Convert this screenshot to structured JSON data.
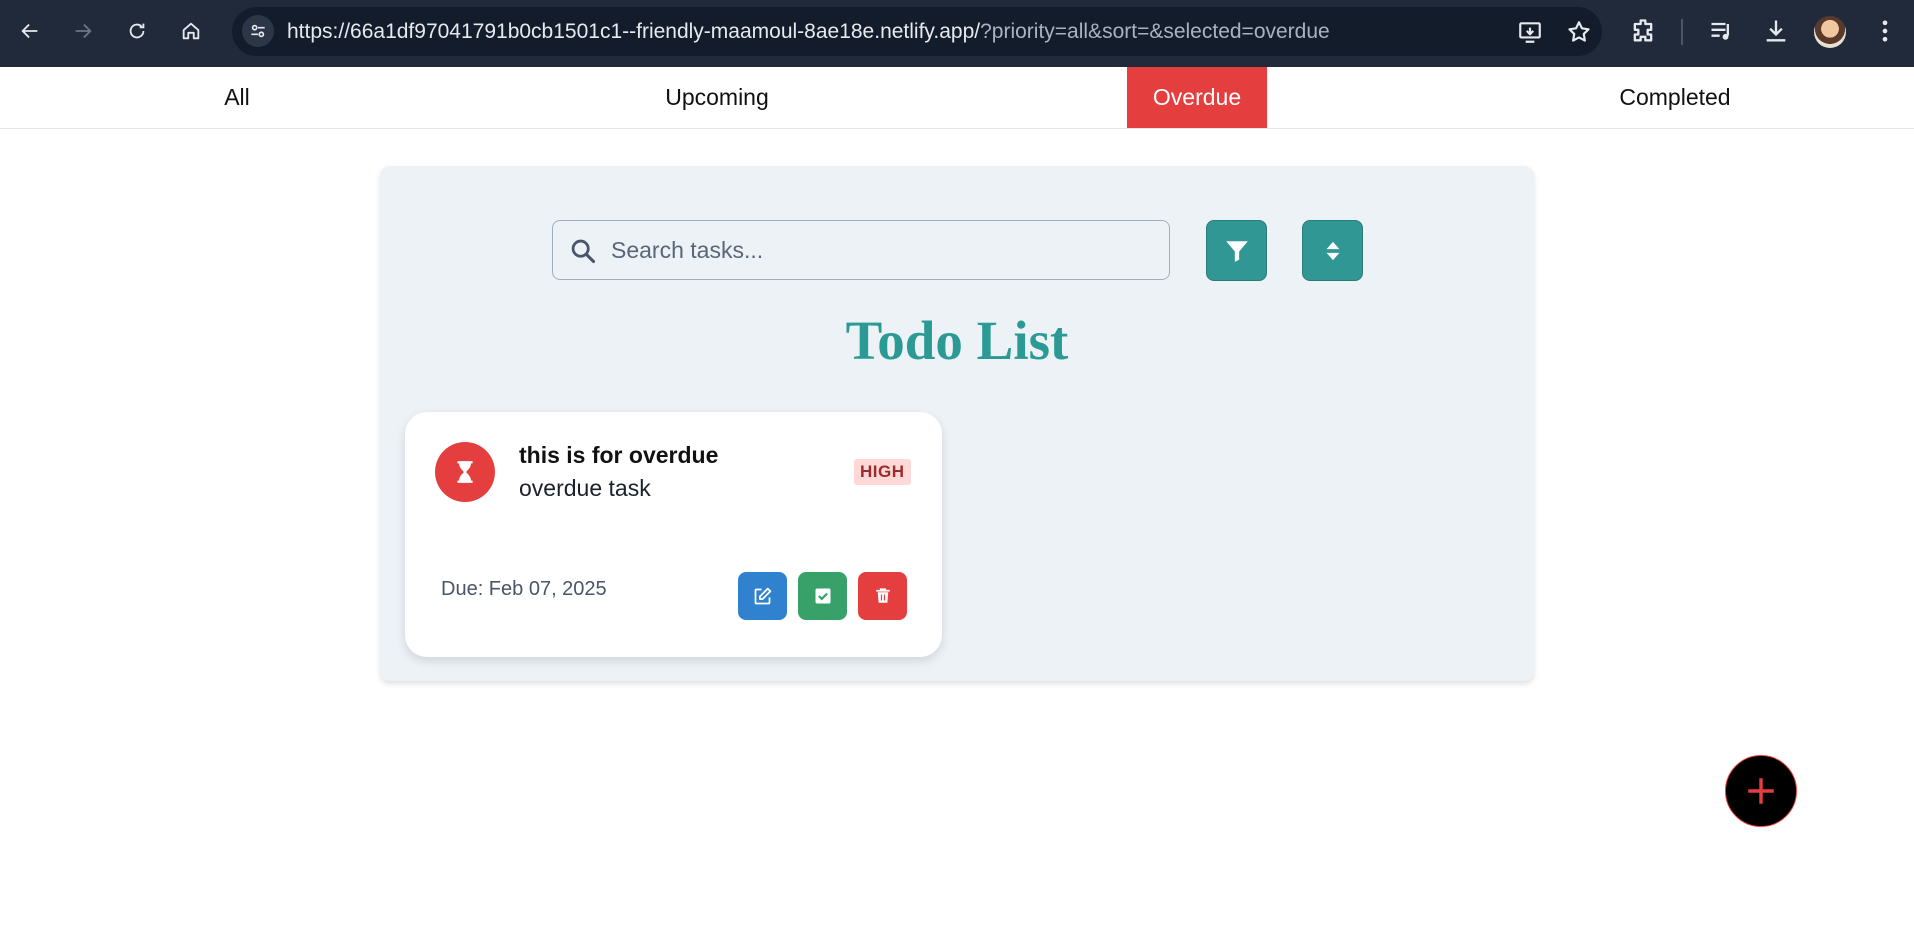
{
  "browser": {
    "url_main": "https://66a1df97041791b0cb1501c1--friendly-maamoul-8ae18e.netlify.app/",
    "url_query": "?priority=all&sort=&selected=overdue"
  },
  "tabs": [
    {
      "label": "All"
    },
    {
      "label": "Upcoming"
    },
    {
      "label": "Overdue"
    },
    {
      "label": "Completed"
    }
  ],
  "active_tab": "Overdue",
  "search": {
    "placeholder": "Search tasks...",
    "value": ""
  },
  "page_title": "Todo List",
  "tasks": [
    {
      "title": "this is for overdue",
      "description": "overdue task",
      "priority": "HIGH",
      "due": "Due: Feb 07, 2025",
      "status_icon": "hourglass-icon"
    }
  ],
  "colors": {
    "accent_teal": "#319795",
    "danger_red": "#e53e3e",
    "edit_blue": "#3182ce",
    "complete_green": "#38a169"
  }
}
